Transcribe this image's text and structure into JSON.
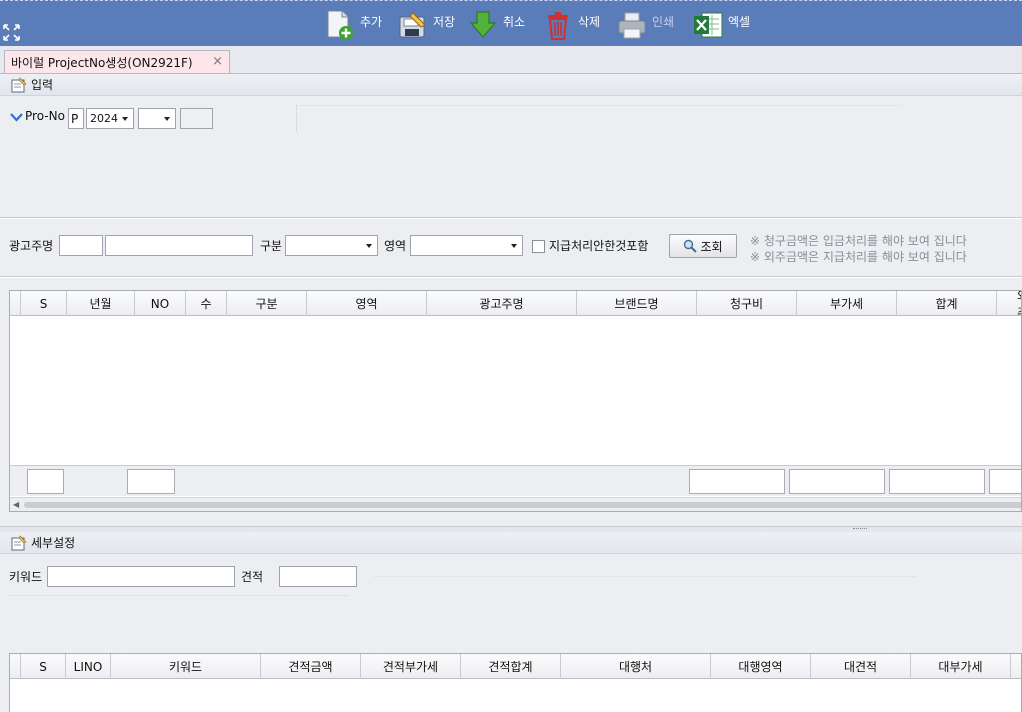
{
  "toolbar": {
    "buttons": [
      {
        "label": "추가",
        "icon": "add-document-icon",
        "enabled": true
      },
      {
        "label": "저장",
        "icon": "save-icon",
        "enabled": true
      },
      {
        "label": "취소",
        "icon": "undo-arrow-icon",
        "enabled": true
      },
      {
        "label": "삭제",
        "icon": "trash-icon",
        "enabled": true
      },
      {
        "label": "인쇄",
        "icon": "printer-icon",
        "enabled": false
      },
      {
        "label": "엑셀",
        "icon": "excel-icon",
        "enabled": true
      }
    ]
  },
  "tab": {
    "title": "바이럴 ProjectNo생성(ON2921F)",
    "close": "×"
  },
  "input_section": {
    "title": "입력",
    "prono_label": "Pro-No",
    "prefix": "P",
    "year": "2024",
    "month": "",
    "seq": ""
  },
  "search": {
    "advertiser_label": "광고주명",
    "advertiser_code": "",
    "advertiser_name": "",
    "category_label": "구분",
    "category_value": "",
    "area_label": "영역",
    "area_value": "",
    "include_unpaid_label": "지급처리안한것포함",
    "include_unpaid": false,
    "search_button": "조회",
    "notes": [
      "※ 청구금액은 입금처리를 해야 보여 집니다",
      "※ 외주금액은 지급처리를 해야 보여 집니다"
    ]
  },
  "main_grid": {
    "columns": [
      "S",
      "년월",
      "NO",
      "수",
      "구분",
      "영역",
      "광고주명",
      "브랜드명",
      "청구비",
      "부가세",
      "합계",
      "외주"
    ],
    "rows": []
  },
  "detail_section": {
    "title": "세부설정",
    "keyword_label": "키워드",
    "keyword_value": "",
    "estimate_label": "견적",
    "estimate_value": ""
  },
  "detail_grid": {
    "columns": [
      "S",
      "LINO",
      "키워드",
      "견적금액",
      "견적부가세",
      "견적합계",
      "대행처",
      "대행영역",
      "대견적",
      "대부가세"
    ],
    "rows": []
  },
  "colors": {
    "toolbar_bg": "#5a7cb8",
    "tab_bg": "#fde6ea",
    "panel_bg": "#eceef2"
  }
}
